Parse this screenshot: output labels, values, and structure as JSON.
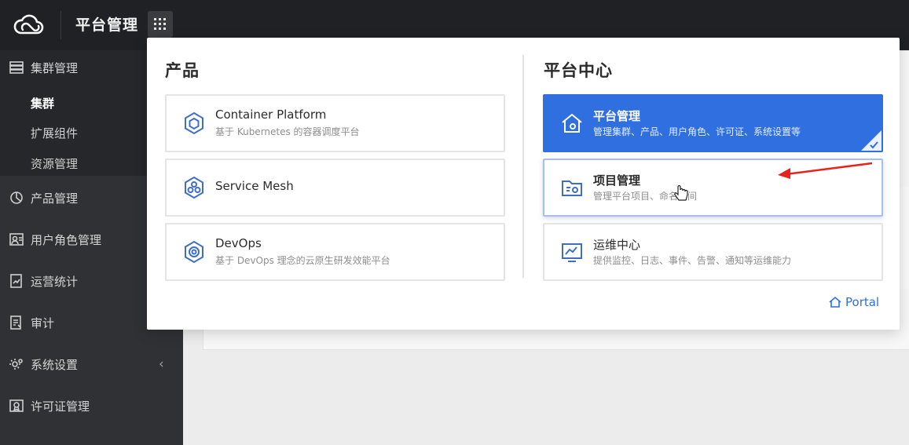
{
  "topbar": {
    "title": "平台管理",
    "logo_icon": "cloud-logo-icon",
    "menu_icon": "grid-menu-icon"
  },
  "sidebar": {
    "items": [
      {
        "label": "集群管理",
        "icon": "cluster-icon"
      },
      {
        "label": "产品管理",
        "icon": "product-icon"
      },
      {
        "label": "用户角色管理",
        "icon": "user-role-icon"
      },
      {
        "label": "运营统计",
        "icon": "statistics-icon"
      },
      {
        "label": "审计",
        "icon": "audit-icon"
      },
      {
        "label": "系统设置",
        "icon": "settings-icon"
      },
      {
        "label": "许可证管理",
        "icon": "license-icon"
      }
    ],
    "subitems": [
      {
        "label": "集群",
        "active": true
      },
      {
        "label": "扩展组件",
        "active": false
      },
      {
        "label": "资源管理",
        "active": false
      }
    ],
    "collapse_icon": "chevron-left-icon"
  },
  "panel": {
    "products": {
      "title": "产品",
      "items": [
        {
          "title": "Container Platform",
          "desc": "基于 Kubernetes 的容器调度平台",
          "icon": "container-platform-icon"
        },
        {
          "title": "Service Mesh",
          "desc": "",
          "icon": "service-mesh-icon"
        },
        {
          "title": "DevOps",
          "desc": "基于 DevOps 理念的云原生研发效能平台",
          "icon": "devops-icon"
        }
      ]
    },
    "platform": {
      "title": "平台中心",
      "items": [
        {
          "title": "平台管理",
          "desc": "管理集群、产品、用户角色、许可证、系统设置等",
          "icon": "platform-manage-icon",
          "selected": true
        },
        {
          "title": "项目管理",
          "desc": "管理平台项目、命名空间",
          "icon": "project-manage-icon",
          "selected": false
        },
        {
          "title": "运维中心",
          "desc": "提供监控、日志、事件、告警、通知等运维能力",
          "icon": "ops-center-icon",
          "selected": false
        }
      ]
    },
    "portal_label": "Portal"
  },
  "colors": {
    "topbar": "#202124",
    "sidebar": "#303134",
    "accent": "#2f6fe0",
    "annotation_arrow": "#e8231b"
  }
}
